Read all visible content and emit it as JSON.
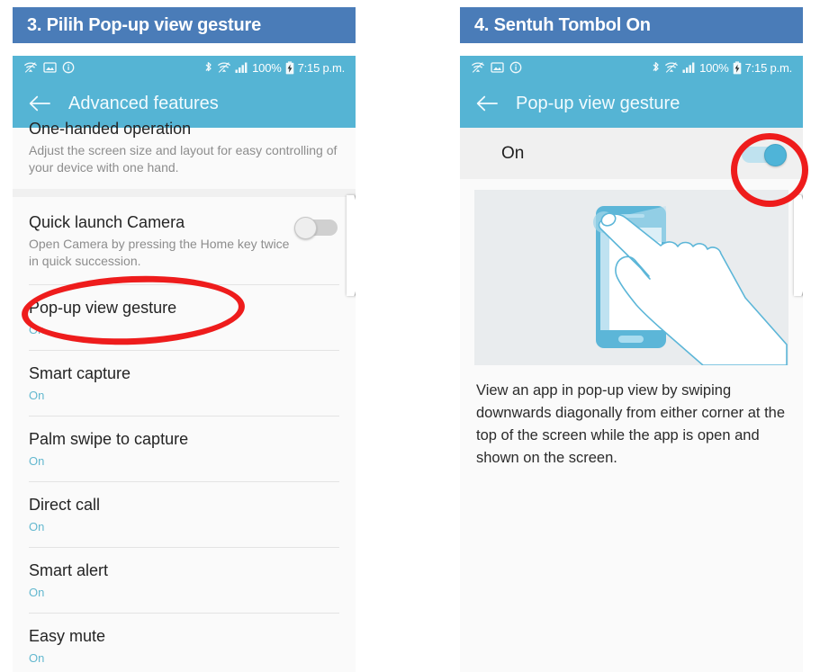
{
  "steps": [
    {
      "id": "step3",
      "header": "3. Pilih Pop-up view gesture"
    },
    {
      "id": "step4",
      "header": "4. Sentuh Tombol On"
    }
  ],
  "colors": {
    "step_header_bg": "#4a7cb8",
    "appbar_bg": "#55b4d4",
    "accent_on": "#63b8cf",
    "annotation_red": "#ee1c1c",
    "toggle_on": "#4fb4d8",
    "list_bg": "#fafafa",
    "illustration_bg": "#e9ecee"
  },
  "statusbar": {
    "left_icons": [
      "wifi-icon",
      "image-icon",
      "info-icon"
    ],
    "right_icons": [
      "bluetooth-icon",
      "wifi-icon",
      "signal-icon"
    ],
    "battery_percent": "100%",
    "battery_icon": "battery-charging-icon",
    "time": "7:15 p.m."
  },
  "left_panel": {
    "appbar": {
      "back_icon": "back-arrow-icon",
      "title": "Advanced features"
    },
    "rows": [
      {
        "title": "One-handed operation",
        "subtitle": "Adjust the screen size and layout for easy controlling of your device with one hand.",
        "sub_style": "muted",
        "toggle": null,
        "clipped": true
      },
      {
        "title": "Quick launch Camera",
        "subtitle": "Open Camera by pressing the Home key twice in quick succession.",
        "sub_style": "muted",
        "toggle": "off"
      },
      {
        "title": "Pop-up view gesture",
        "subtitle": "On",
        "sub_style": "on",
        "toggle": null,
        "highlighted": true
      },
      {
        "title": "Smart capture",
        "subtitle": "On",
        "sub_style": "on",
        "toggle": null
      },
      {
        "title": "Palm swipe to capture",
        "subtitle": "On",
        "sub_style": "on",
        "toggle": null
      },
      {
        "title": "Direct call",
        "subtitle": "On",
        "sub_style": "on",
        "toggle": null
      },
      {
        "title": "Smart alert",
        "subtitle": "On",
        "sub_style": "on",
        "toggle": null
      },
      {
        "title": "Easy mute",
        "subtitle": "On",
        "sub_style": "on",
        "toggle": null
      }
    ]
  },
  "right_panel": {
    "appbar": {
      "back_icon": "back-arrow-icon",
      "title": "Pop-up view gesture"
    },
    "switch_row": {
      "label": "On",
      "state": "on"
    },
    "illustration_name": "hand-swipe-phone-illustration",
    "description": "View an app in pop-up view by swiping downwards diagonally from either corner at the top of the screen while the app is open and shown on the screen."
  }
}
